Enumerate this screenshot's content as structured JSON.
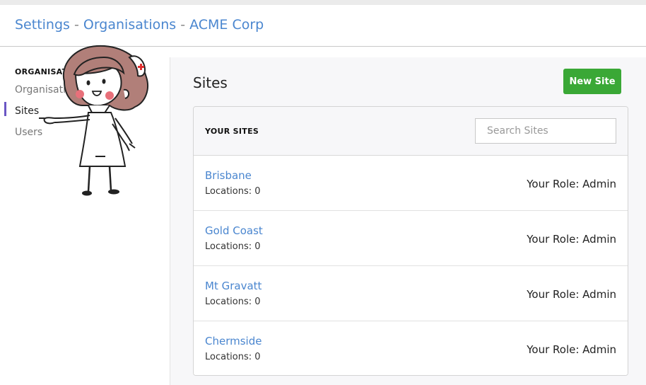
{
  "breadcrumb": {
    "settings": "Settings",
    "sep1": " - ",
    "organisations": "Organisations",
    "sep2": " - ",
    "current": "ACME Corp"
  },
  "sidebar": {
    "heading": "ORGANISATION",
    "items": [
      {
        "label": "Organisations",
        "active": false
      },
      {
        "label": "Sites",
        "active": true
      },
      {
        "label": "Users",
        "active": false
      }
    ]
  },
  "main": {
    "title": "Sites",
    "new_button": "New Site",
    "panel_title": "YOUR SITES",
    "search_placeholder": "Search Sites",
    "sites": [
      {
        "name": "Brisbane",
        "locations": "Locations: 0",
        "role": "Your Role: Admin"
      },
      {
        "name": "Gold Coast",
        "locations": "Locations: 0",
        "role": "Your Role: Admin"
      },
      {
        "name": "Mt Gravatt",
        "locations": "Locations: 0",
        "role": "Your Role: Admin"
      },
      {
        "name": "Chermside",
        "locations": "Locations: 0",
        "role": "Your Role: Admin"
      }
    ]
  },
  "colors": {
    "link": "#4a86cf",
    "accent": "#6a56c4",
    "button": "#3aa836"
  },
  "mascot": {
    "icon": "nurse-mascot-icon"
  }
}
